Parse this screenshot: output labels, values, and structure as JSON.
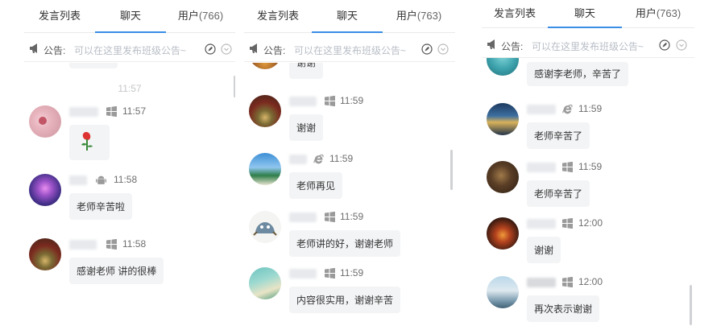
{
  "panels": [
    {
      "tabs": [
        {
          "label": "发言列表"
        },
        {
          "label": "聊天"
        },
        {
          "label": "用户",
          "count": "(766)"
        }
      ],
      "notice": {
        "label": "公告:",
        "hint": "可以在这里发布班级公告~"
      },
      "divider_time": "11:57",
      "messages": [
        {
          "time": "11:57",
          "platform": "windows-icon",
          "text": "",
          "is_sticker": true
        },
        {
          "time": "11:58",
          "platform": "android-icon",
          "text": "老师辛苦啦"
        },
        {
          "time": "11:58",
          "platform": "windows-icon",
          "text": "感谢老师 讲的很棒"
        }
      ]
    },
    {
      "tabs": [
        {
          "label": "发言列表"
        },
        {
          "label": "聊天"
        },
        {
          "label": "用户",
          "count": "(763)"
        }
      ],
      "notice": {
        "label": "公告:",
        "hint": "可以在这里发布班级公告~"
      },
      "partial_text": "谢谢",
      "messages": [
        {
          "time": "11:59",
          "platform": "windows-icon",
          "text": "谢谢"
        },
        {
          "time": "11:59",
          "platform": "ie-icon",
          "text": "老师再见"
        },
        {
          "time": "11:59",
          "platform": "windows-icon",
          "text": "老师讲的好，谢谢老师"
        },
        {
          "time": "11:59",
          "platform": "windows-icon",
          "text": "内容很实用，谢谢辛苦"
        }
      ]
    },
    {
      "tabs": [
        {
          "label": "发言列表"
        },
        {
          "label": "聊天"
        },
        {
          "label": "用户",
          "count": "(763)"
        }
      ],
      "notice": {
        "label": "公告:",
        "hint": "可以在这里发布班级公告~"
      },
      "partial_text": "感谢李老师，辛苦了",
      "messages": [
        {
          "time": "11:59",
          "platform": "ie-icon",
          "text": "老师辛苦了"
        },
        {
          "time": "11:59",
          "platform": "windows-icon",
          "text": "老师辛苦了"
        },
        {
          "time": "12:00",
          "platform": "windows-icon",
          "text": "谢谢"
        },
        {
          "time": "12:00",
          "platform": "windows-icon",
          "text": "再次表示谢谢"
        }
      ]
    }
  ],
  "colors": {
    "accent": "#3a8ee6",
    "bubble": "#f3f4f6",
    "hint": "#b8bec6"
  }
}
